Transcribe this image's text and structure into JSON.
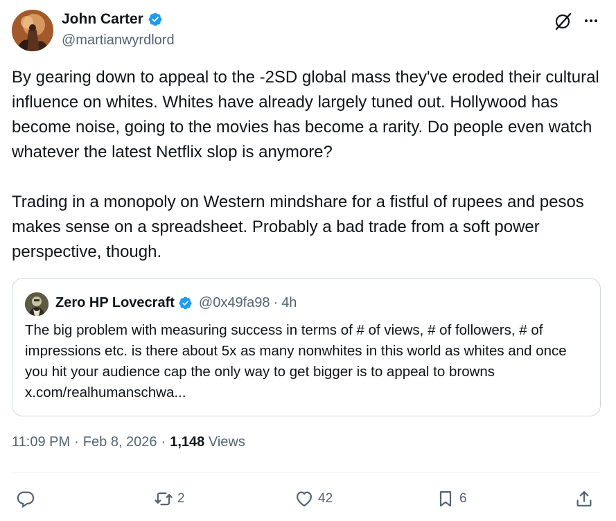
{
  "author": {
    "display_name": "John Carter",
    "handle": "@martianwyrdlord",
    "verified": true,
    "avatar_icon": "avatar-image"
  },
  "header_icons": {
    "grok": "grok-icon",
    "more": "more-icon"
  },
  "tweet": {
    "text": "By gearing down to appeal to the -2SD global mass they've eroded their cultural influence on whites. Whites have already largely tuned out. Hollywood has become noise, going to the movies has become a rarity. Do people even watch whatever the latest Netflix slop is anymore?\n\nTrading in a monopoly on Western mindshare for a fistful of rupees and pesos makes sense on a spreadsheet. Probably a bad trade from a soft power perspective, though."
  },
  "quote": {
    "display_name": "Zero HP Lovecraft",
    "handle": "@0x49fa98",
    "separator": "·",
    "time": "4h",
    "verified": true,
    "text": "The big problem with measuring success in terms of # of views, # of followers, # of impressions etc. is there about 5x as many nonwhites in this world as whites and once you hit your audience cap the only way to get bigger is to appeal to browns x.com/realhumanschwa..."
  },
  "meta": {
    "time": "11:09 PM",
    "sep1": "·",
    "date": "Feb 8, 2026",
    "sep2": "·",
    "views_count": "1,148",
    "views_label": "Views"
  },
  "actions": {
    "reply_count": "",
    "repost_count": "2",
    "like_count": "42",
    "bookmark_count": "6"
  },
  "colors": {
    "text_primary": "#0f1419",
    "text_secondary": "#536471",
    "verified_blue": "#1d9bf0",
    "border": "#cfd9de",
    "divider": "#eff3f4"
  }
}
